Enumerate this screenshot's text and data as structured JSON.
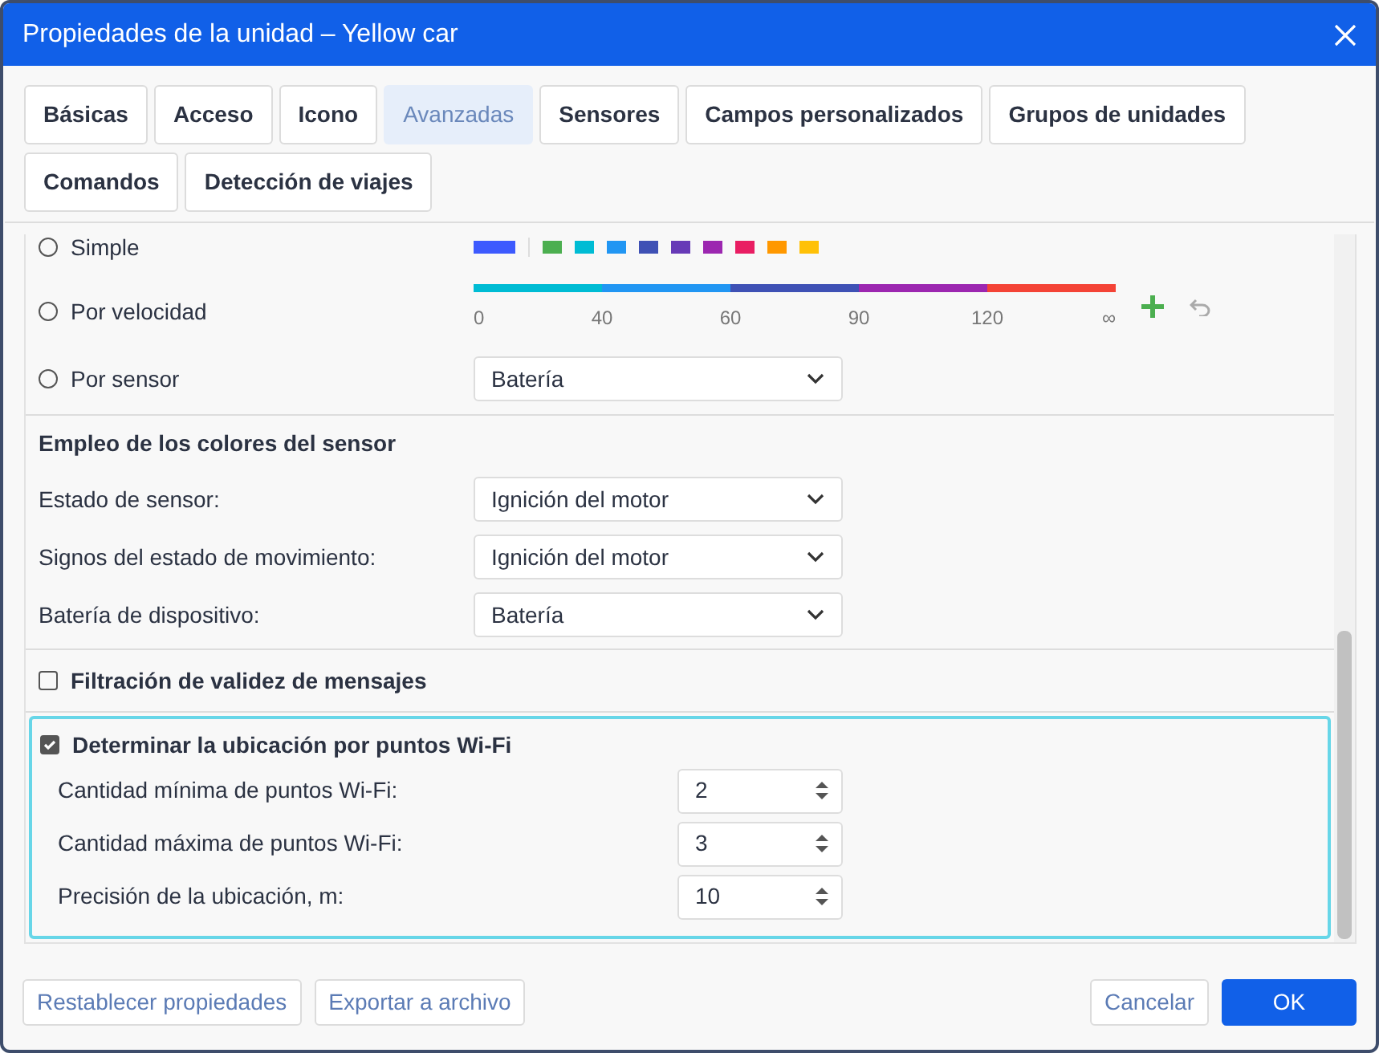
{
  "window": {
    "title": "Propiedades de la unidad – Yellow car"
  },
  "tabs": [
    {
      "label": "Básicas",
      "selected": false
    },
    {
      "label": "Acceso",
      "selected": false
    },
    {
      "label": "Icono",
      "selected": false
    },
    {
      "label": "Avanzadas",
      "selected": true
    },
    {
      "label": "Sensores",
      "selected": false
    },
    {
      "label": "Campos personalizados",
      "selected": false
    },
    {
      "label": "Grupos de unidades",
      "selected": false
    },
    {
      "label": "Comandos",
      "selected": false
    },
    {
      "label": "Detección de viajes",
      "selected": false
    }
  ],
  "track_color": [
    {
      "kind": "palette",
      "label": "Simple",
      "selected": false,
      "current": {
        "color": "#3d5afe"
      },
      "swatches": [
        {
          "color": "#4caf50"
        },
        {
          "color": "#00bcd4"
        },
        {
          "color": "#2196f3"
        },
        {
          "color": "#3f51b5"
        },
        {
          "color": "#673ab7"
        },
        {
          "color": "#9c27b0"
        },
        {
          "color": "#e91e63"
        },
        {
          "color": "#ff9800"
        },
        {
          "color": "#ffc107"
        }
      ]
    },
    {
      "kind": "speed",
      "label": "Por velocidad",
      "selected": false,
      "segments": [
        {
          "color": "#00bcd4",
          "from": "0"
        },
        {
          "color": "#2196f3",
          "from": "40"
        },
        {
          "color": "#3f51b5",
          "from": "60"
        },
        {
          "color": "#9c27b0",
          "from": "90"
        },
        {
          "color": "#f44336",
          "from": "120"
        }
      ],
      "end_label": "∞"
    },
    {
      "kind": "select",
      "label": "Por sensor",
      "selected": false,
      "value": "Batería"
    }
  ],
  "sensor_colors": {
    "title": "Empleo de los colores del sensor",
    "fields": [
      {
        "label": "Estado de sensor:",
        "value": "Ignición del motor"
      },
      {
        "label": "Signos del estado de movimiento:",
        "value": "Ignición del motor"
      },
      {
        "label": "Batería de dispositivo:",
        "value": "Batería"
      }
    ]
  },
  "message_filter": {
    "label": "Filtración de validez de mensajes",
    "checked": false
  },
  "wifi": {
    "label": "Determinar la ubicación por puntos Wi-Fi",
    "checked": true,
    "fields": [
      {
        "label": "Cantidad mínima de puntos Wi-Fi:",
        "value": "2"
      },
      {
        "label": "Cantidad máxima de puntos Wi-Fi:",
        "value": "3"
      },
      {
        "label": "Precisión de la ubicación, m:",
        "value": "10"
      }
    ]
  },
  "footer": {
    "left_buttons": [
      {
        "label": "Restablecer propiedades",
        "kind": "secondary"
      },
      {
        "label": "Exportar a archivo",
        "kind": "secondary"
      }
    ],
    "right_buttons": [
      {
        "label": "Cancelar",
        "kind": "secondary"
      },
      {
        "label": "OK",
        "kind": "primary"
      }
    ]
  }
}
